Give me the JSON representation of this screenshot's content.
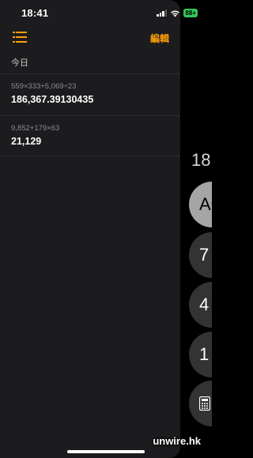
{
  "status_bar": {
    "time": "18:41",
    "battery": "88+"
  },
  "toolbar": {
    "list_icon": "list-icon",
    "edit_label": "編輯"
  },
  "history": {
    "section_title": "今日",
    "entries": [
      {
        "expression": "559×333+5,069÷23",
        "result": "186,367.39130435"
      },
      {
        "expression": "9,852+179×63",
        "result": "21,129"
      }
    ]
  },
  "calculator": {
    "display": "18",
    "keys": {
      "ac": "AC",
      "seven": "7",
      "four": "4",
      "one": "1",
      "calc_icon": "calculator-icon"
    }
  },
  "watermark": "unwire.hk",
  "colors": {
    "accent": "#ff9f0a",
    "panel": "#1c1c1e",
    "battery": "#34c759"
  }
}
